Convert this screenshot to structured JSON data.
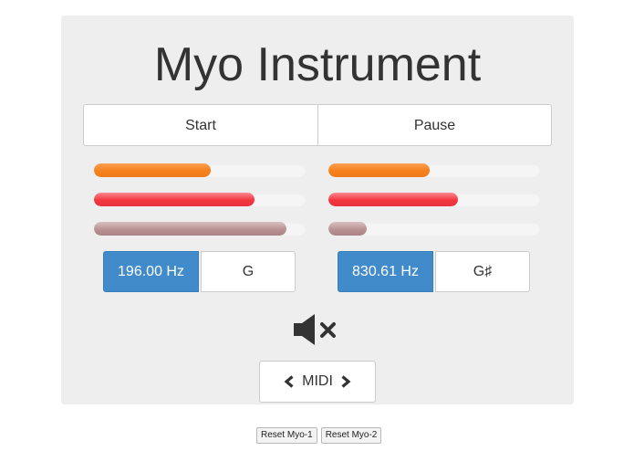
{
  "title": "Myo Instrument",
  "controls": {
    "start_label": "Start",
    "pause_label": "Pause"
  },
  "channels": [
    {
      "bars": [
        {
          "color": "#f6821f",
          "level": 0.55
        },
        {
          "color": "#f23640",
          "level": 0.76
        },
        {
          "color": "#b99394",
          "level": 0.91
        }
      ],
      "frequency": "196.00 Hz",
      "note": "G"
    },
    {
      "bars": [
        {
          "color": "#f6821f",
          "level": 0.48
        },
        {
          "color": "#f23640",
          "level": 0.61
        },
        {
          "color": "#b99394",
          "level": 0.18
        }
      ],
      "frequency": "830.61 Hz",
      "note": "G♯"
    }
  ],
  "mute_icon": "volume-mute-icon",
  "midi": {
    "label": "MIDI",
    "prev_icon": "chevron-left-icon",
    "next_icon": "chevron-right-icon"
  },
  "reset": {
    "myo1_label": "Reset Myo-1",
    "myo2_label": "Reset Myo-2"
  },
  "colors": {
    "accent_blue": "#428bca",
    "panel_bg": "#eeeeee"
  }
}
